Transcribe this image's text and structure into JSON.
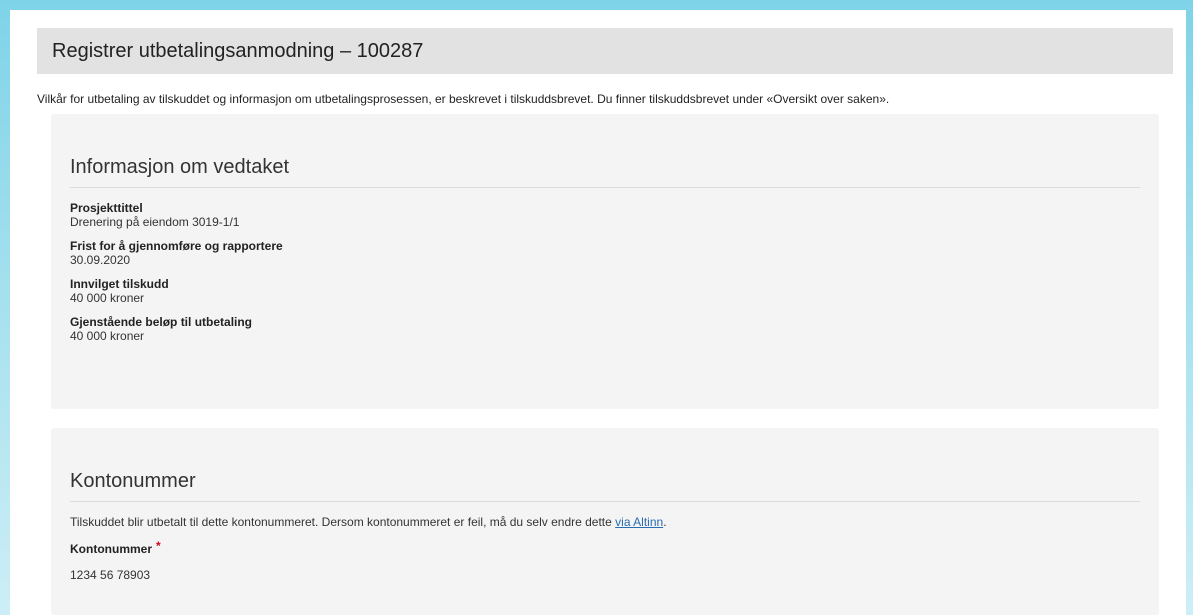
{
  "page_title": "Registrer utbetalingsanmodning – 100287",
  "intro_text": "Vilkår for utbetaling av tilskuddet og informasjon om utbetalingsprosessen, er beskrevet i tilskuddsbrevet. Du finner tilskuddsbrevet under «Oversikt over saken».",
  "vedtak": {
    "heading": "Informasjon om vedtaket",
    "fields": [
      {
        "label": "Prosjekttittel",
        "value": "Drenering på eiendom 3019-1/1"
      },
      {
        "label": "Frist for å gjennomføre og rapportere",
        "value": "30.09.2020"
      },
      {
        "label": "Innvilget tilskudd",
        "value": "40 000 kroner"
      },
      {
        "label": "Gjenstående beløp til utbetaling",
        "value": "40 000 kroner"
      }
    ]
  },
  "konto": {
    "heading": "Kontonummer",
    "text_before_link": "Tilskuddet blir utbetalt til dette kontonummeret. Dersom kontonummeret er feil, må du selv endre dette ",
    "link_text": "via Altinn",
    "text_after_link": ".",
    "field_label": "Kontonummer",
    "required_marker": "*",
    "field_value": "1234 56 78903"
  }
}
